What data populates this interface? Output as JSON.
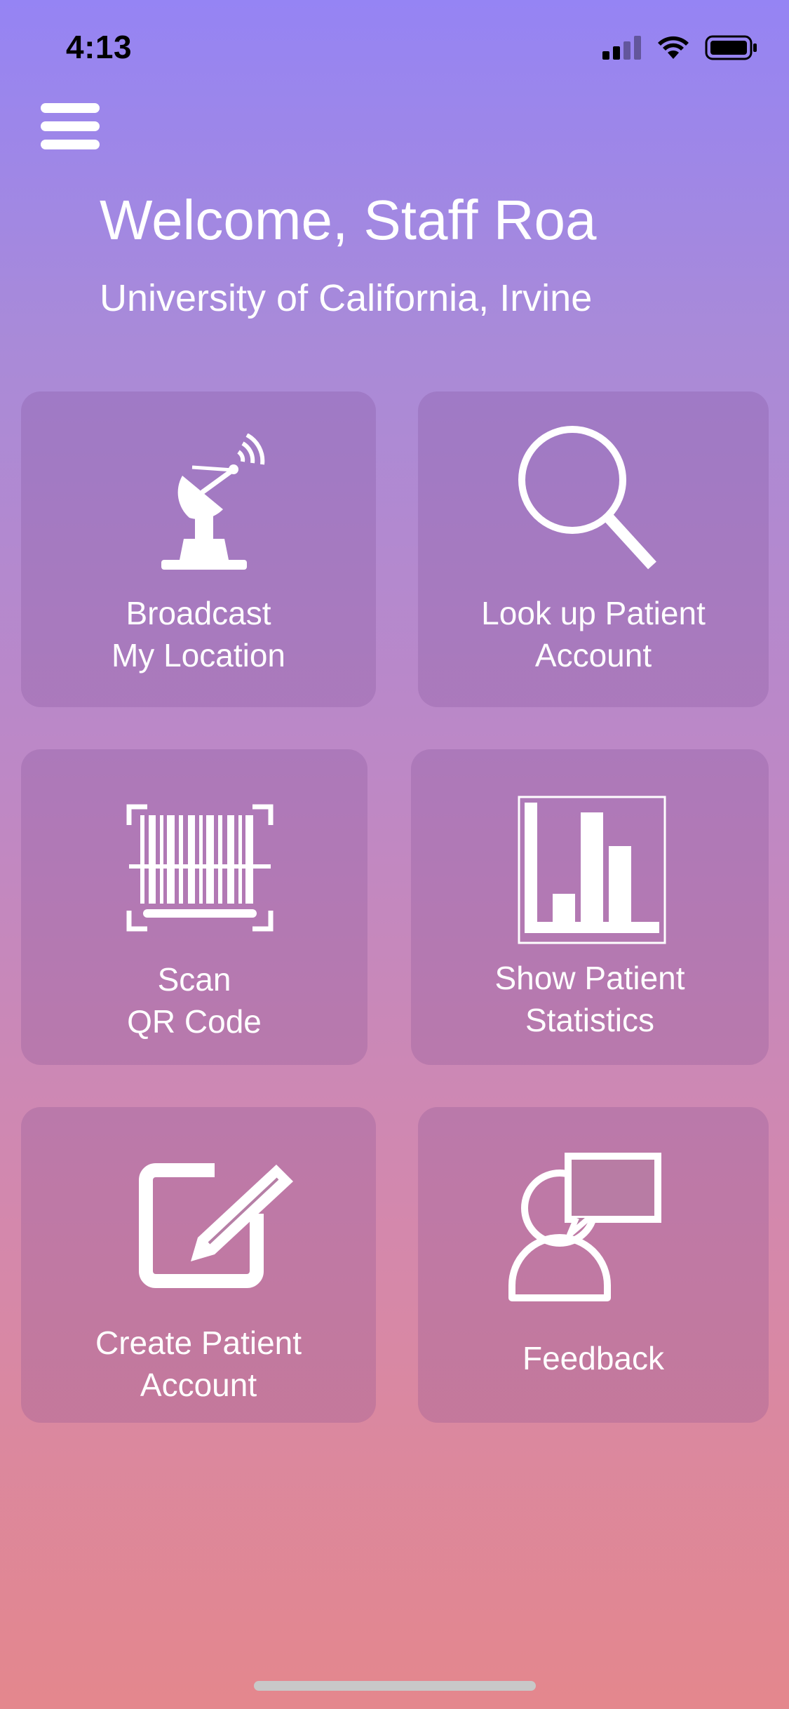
{
  "status_bar": {
    "time": "4:13"
  },
  "header": {
    "title": "Welcome, Staff Roa",
    "subtitle": "University of California, Irvine"
  },
  "tiles": [
    {
      "label": "Broadcast\nMy Location",
      "icon": "satellite-dish-icon"
    },
    {
      "label": "Look up Patient\nAccount",
      "icon": "search-icon"
    },
    {
      "label": "Scan\nQR Code",
      "icon": "barcode-scan-icon"
    },
    {
      "label": "Show Patient\nStatistics",
      "icon": "bar-chart-icon"
    },
    {
      "label": "Create Patient\nAccount",
      "icon": "edit-icon"
    },
    {
      "label": "Feedback",
      "icon": "feedback-person-icon"
    }
  ],
  "colors": {
    "gradient_top": "#9584f4",
    "gradient_bottom": "#e4878d",
    "tile_tint": "#784690"
  }
}
